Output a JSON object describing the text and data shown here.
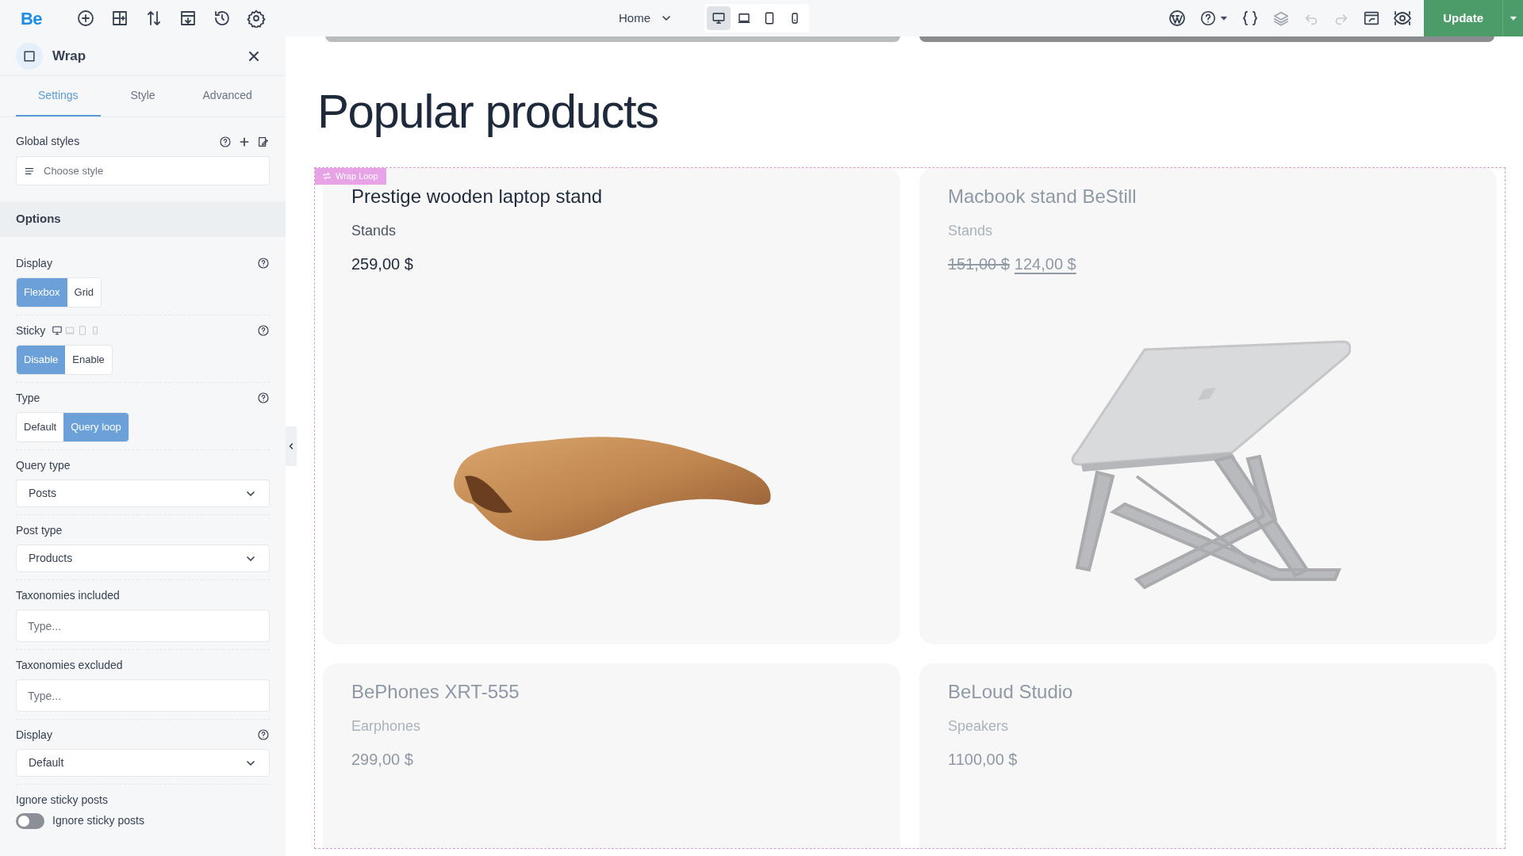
{
  "topbar": {
    "logo": "Be",
    "page_select": "Home",
    "devices": [
      {
        "kind": "desktop",
        "selected": true
      },
      {
        "kind": "laptop",
        "selected": false
      },
      {
        "kind": "tablet",
        "selected": false
      },
      {
        "kind": "mobile",
        "selected": false
      }
    ],
    "update_button": "Update"
  },
  "sidebar": {
    "element_title": "Wrap",
    "tabs": [
      {
        "label": "Settings",
        "selected": true
      },
      {
        "label": "Style",
        "selected": false
      },
      {
        "label": "Advanced",
        "selected": false
      }
    ],
    "global_styles": {
      "label": "Global styles",
      "placeholder": "Choose style"
    },
    "section": "Options",
    "fields": [
      {
        "kind": "segmented",
        "label": "Display",
        "help": true,
        "options": [
          {
            "label": "Flexbox",
            "selected": true
          },
          {
            "label": "Grid",
            "selected": false
          }
        ]
      },
      {
        "kind": "segmented",
        "label": "Sticky",
        "help": true,
        "devices": true,
        "options": [
          {
            "label": "Disable",
            "selected": true
          },
          {
            "label": "Enable",
            "selected": false
          }
        ]
      },
      {
        "kind": "segmented",
        "label": "Type",
        "help": true,
        "options": [
          {
            "label": "Default",
            "selected": false
          },
          {
            "label": "Query loop",
            "selected": true
          }
        ]
      },
      {
        "kind": "select",
        "label": "Query type",
        "help": false,
        "value": "Posts"
      },
      {
        "kind": "select",
        "label": "Post type",
        "help": false,
        "value": "Products"
      },
      {
        "kind": "input",
        "label": "Taxonomies included",
        "help": false,
        "placeholder": "Type..."
      },
      {
        "kind": "input",
        "label": "Taxonomies excluded",
        "help": false,
        "placeholder": "Type..."
      },
      {
        "kind": "select",
        "label": "Display",
        "help": true,
        "value": "Default"
      },
      {
        "kind": "toggle",
        "label": "Ignore sticky posts",
        "help": false,
        "toggle_label": "Ignore sticky posts",
        "on": false
      }
    ]
  },
  "canvas": {
    "heading": "Popular products",
    "wrap_badge": "Wrap Loop",
    "products": [
      {
        "name": "Prestige wooden laptop stand",
        "category": "Stands",
        "price": "259,00 $",
        "faded": false
      },
      {
        "name": "Macbook stand BeStill",
        "category": "Stands",
        "old_price": "151,00 $",
        "price": "124,00 $",
        "faded": true
      },
      {
        "name": "BePhones XRT-555",
        "category": "Earphones",
        "price": "299,00 $",
        "faded": true
      },
      {
        "name": "BeLoud Studio",
        "category": "Speakers",
        "price": "1100,00 $",
        "faded": true
      }
    ]
  }
}
